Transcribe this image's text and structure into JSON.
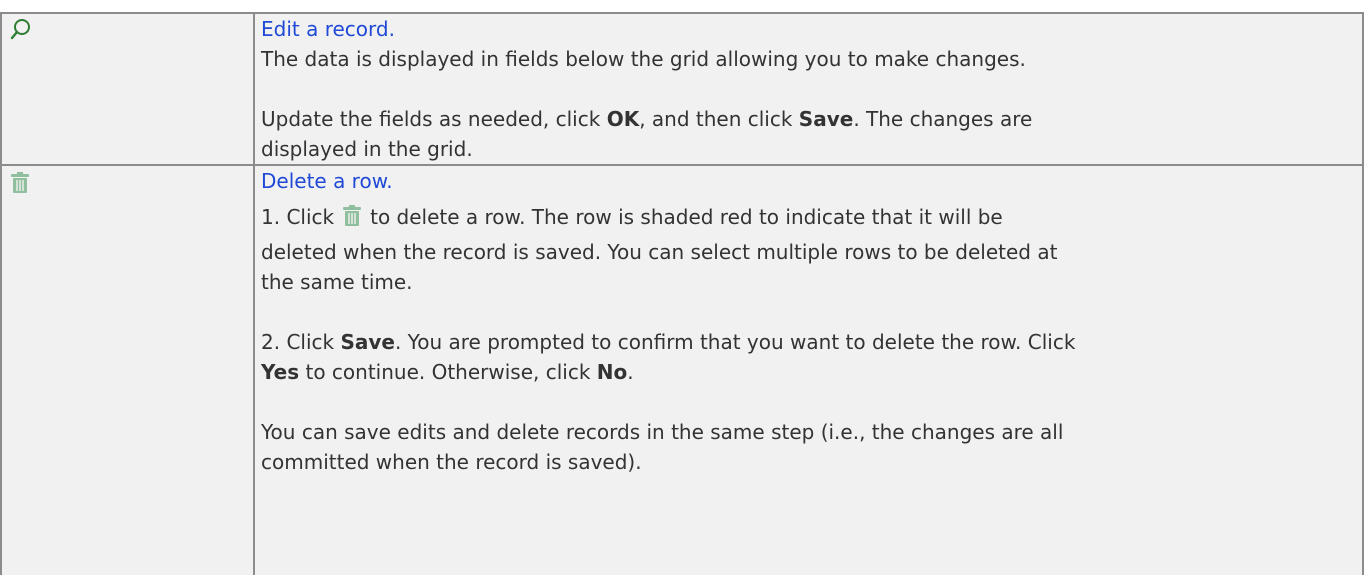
{
  "rows": [
    {
      "icon": "magnifier-icon",
      "title": "Edit a record.",
      "lines": [
        "The data is displayed in fields below the grid allowing you to make changes."
      ],
      "update_parts": [
        "Update the fields as needed, click ",
        "OK",
        ", and then click ",
        "Save",
        ". The changes are"
      ],
      "update_line2": "displayed in the grid."
    },
    {
      "icon": "trash-can-icon",
      "title": "Delete a row.",
      "step1_prefix": "1. Click",
      "step1_suffix": "to delete a row. The row is shaded red to indicate that it will be",
      "step1_line2": "deleted when the record is saved. You can select multiple rows to be deleted at",
      "step1_line3": "the same time.",
      "step2_parts": [
        "2. Click ",
        "Save",
        ". You are prompted to confirm that you want to delete the row. Click"
      ],
      "step2_line2_parts": [
        "Yes",
        " to continue. Otherwise, click ",
        "No",
        "."
      ],
      "note_line1": "You can save edits and delete records in the same step (i.e., the changes are all",
      "note_line2": "committed when the record is saved)."
    }
  ],
  "colors": {
    "link": "#1f49d6",
    "cell_background": "#f1f1f1",
    "border": "#8c8c8c",
    "icon_green": "#2e7d32",
    "trash_green": "#8fbf9f"
  }
}
